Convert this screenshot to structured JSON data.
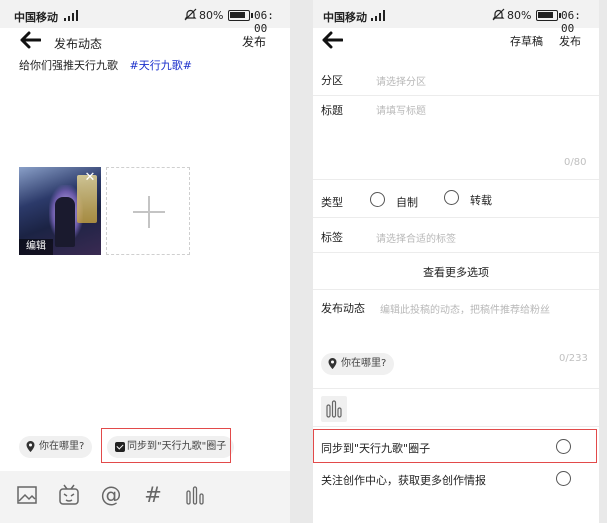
{
  "left": {
    "status": {
      "carrier": "中国移动",
      "battery_pct": "80%",
      "time": "06: 00"
    },
    "nav": {
      "title": "发布动态",
      "publish_label": "发布"
    },
    "content_text": "给你们强推天行九歌",
    "hashtag": "#天行九歌#",
    "thumbnail": {
      "close_glyph": "✕",
      "edit_label": "编辑"
    },
    "location_pill": "你在哪里?",
    "sync_pill": "同步到\"天行九歌\"圈子",
    "toolbar": {
      "at_glyph": "@",
      "hash_glyph": "#"
    }
  },
  "right": {
    "status": {
      "carrier": "中国移动",
      "battery_pct": "80%",
      "time": "06: 00"
    },
    "nav": {
      "draft_label": "存草稿",
      "publish_label": "发布"
    },
    "section": {
      "label": "分区",
      "placeholder": "请选择分区"
    },
    "title_field": {
      "label": "标题",
      "placeholder": "请填写标题",
      "counter": "0/80"
    },
    "type": {
      "label": "类型",
      "option1": "自制",
      "option2": "转载"
    },
    "tags": {
      "label": "标签",
      "placeholder": "请选择合适的标签"
    },
    "more_options": "查看更多选项",
    "dynamic": {
      "label": "发布动态",
      "placeholder": "编辑此投稿的动态，把稿件推荐给粉丝",
      "counter": "0/233"
    },
    "location_pill": "你在哪里?",
    "sync_row": "同步到\"天行九歌\"圈子",
    "follow_row": "关注创作中心，获取更多创作情报"
  },
  "colors": {
    "hashtag": "#1a2ecb",
    "highlight_box": "#e24a4a"
  }
}
